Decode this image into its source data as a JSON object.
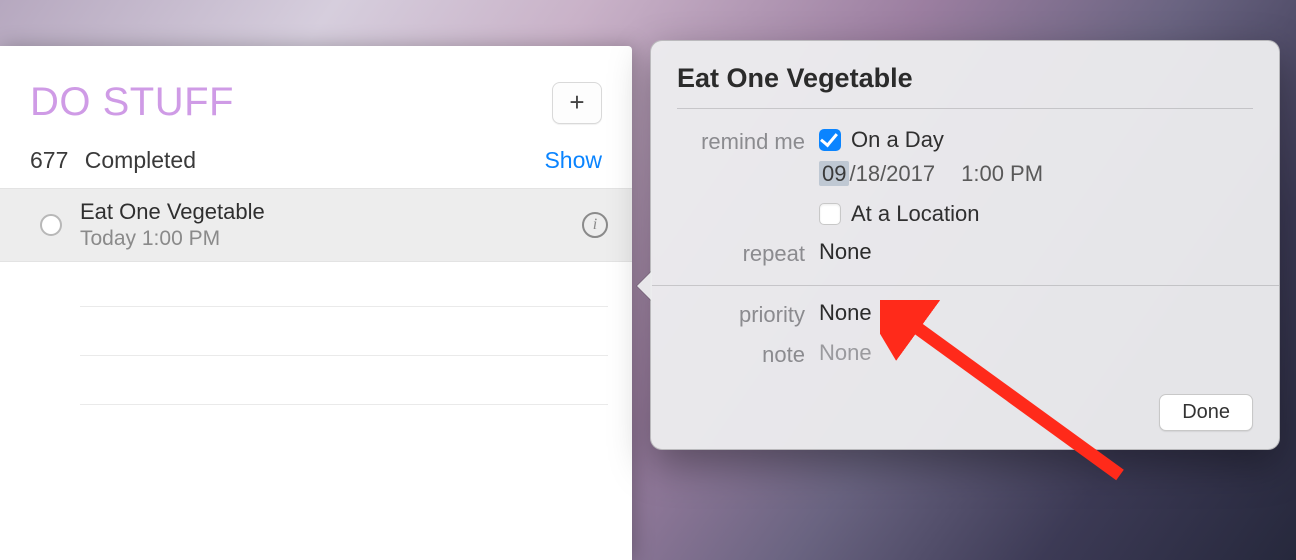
{
  "list": {
    "title": "DO STUFF",
    "completed_count": "677",
    "completed_label": "Completed",
    "show_label": "Show",
    "item": {
      "title": "Eat One Vegetable",
      "subtitle": "Today 1:00 PM"
    }
  },
  "popover": {
    "title": "Eat One Vegetable",
    "labels": {
      "remind": "remind me",
      "repeat": "repeat",
      "priority": "priority",
      "note": "note"
    },
    "on_day": {
      "label": "On a Day",
      "checked": true,
      "date_month": "09",
      "date_rest": "/18/2017",
      "time": "1:00 PM"
    },
    "at_location": {
      "label": "At a Location",
      "checked": false
    },
    "repeat_value": "None",
    "priority_value": "None",
    "note_value": "None",
    "done_label": "Done"
  },
  "icons": {
    "plus": "+",
    "info": "i"
  }
}
